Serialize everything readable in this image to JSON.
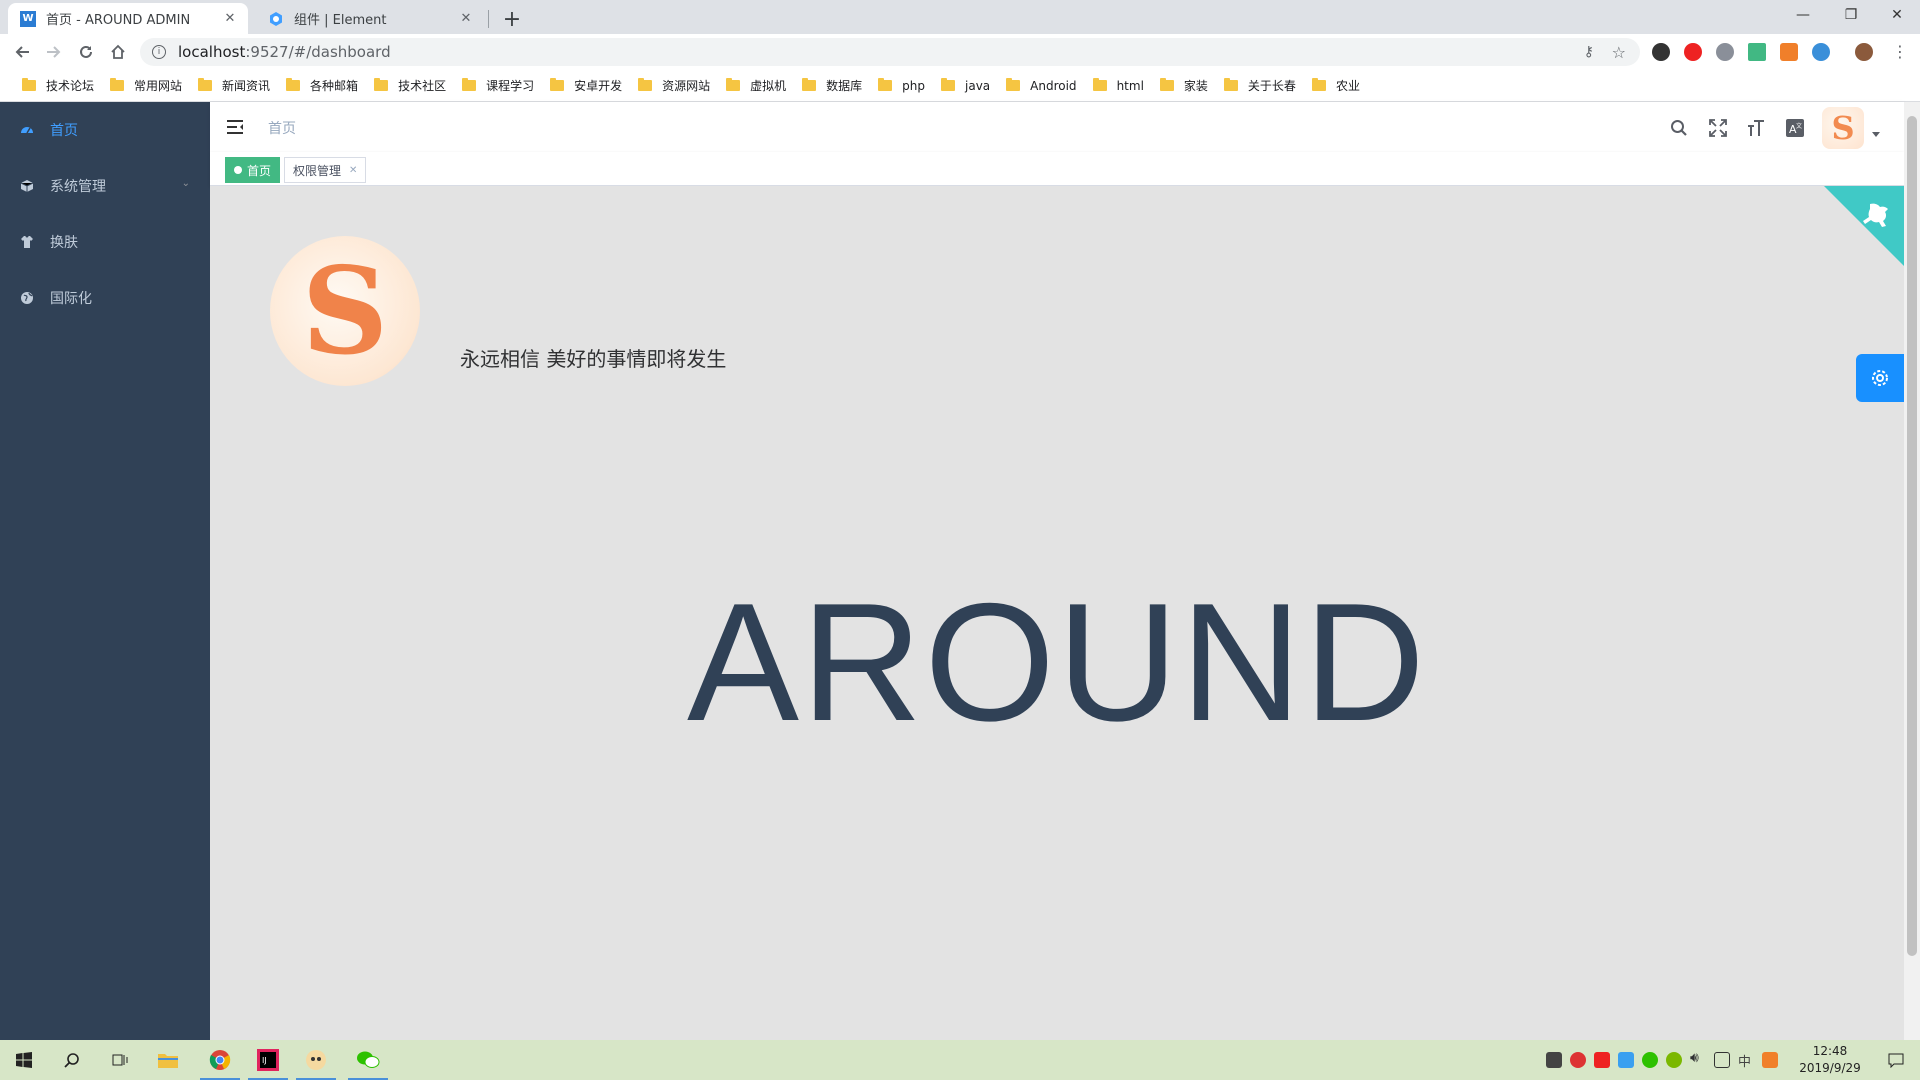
{
  "browser": {
    "tabs": [
      {
        "title": "首页 - AROUND ADMIN",
        "favicon": "W",
        "active": true
      },
      {
        "title": "组件 | Element",
        "favicon": "element",
        "active": false
      }
    ],
    "new_tab": "+",
    "address": {
      "host": "localhost",
      "path": ":9527/#/dashboard"
    },
    "bookmarks": [
      "技术论坛",
      "常用网站",
      "新闻资讯",
      "各种邮箱",
      "技术社区",
      "课程学习",
      "安卓开发",
      "资源网站",
      "虚拟机",
      "数据库",
      "php",
      "java",
      "Android",
      "html",
      "家装",
      "关于长春",
      "农业"
    ]
  },
  "sidebar": {
    "items": [
      {
        "label": "首页",
        "icon": "dashboard-icon",
        "active": true
      },
      {
        "label": "系统管理",
        "icon": "cube-icon",
        "active": false,
        "has_submenu": true
      },
      {
        "label": "换肤",
        "icon": "shirt-icon",
        "active": false
      },
      {
        "label": "国际化",
        "icon": "globe-icon",
        "active": false
      }
    ]
  },
  "navbar": {
    "breadcrumb": "首页",
    "avatar_letter": "S"
  },
  "tags": [
    {
      "label": "首页",
      "active": true
    },
    {
      "label": "权限管理",
      "active": false
    }
  ],
  "dashboard": {
    "avatar_letter": "S",
    "motto": "永远相信 美好的事情即将发生",
    "brand": "AROUND"
  },
  "taskbar": {
    "time": "12:48",
    "date": "2019/9/29"
  },
  "colors": {
    "sidebar_bg": "#304156",
    "accent": "#409eff",
    "tag_active": "#42b983",
    "main_bg": "#e3e3e3",
    "github_corner": "#40c9c6",
    "settings_btn": "#1890ff"
  }
}
